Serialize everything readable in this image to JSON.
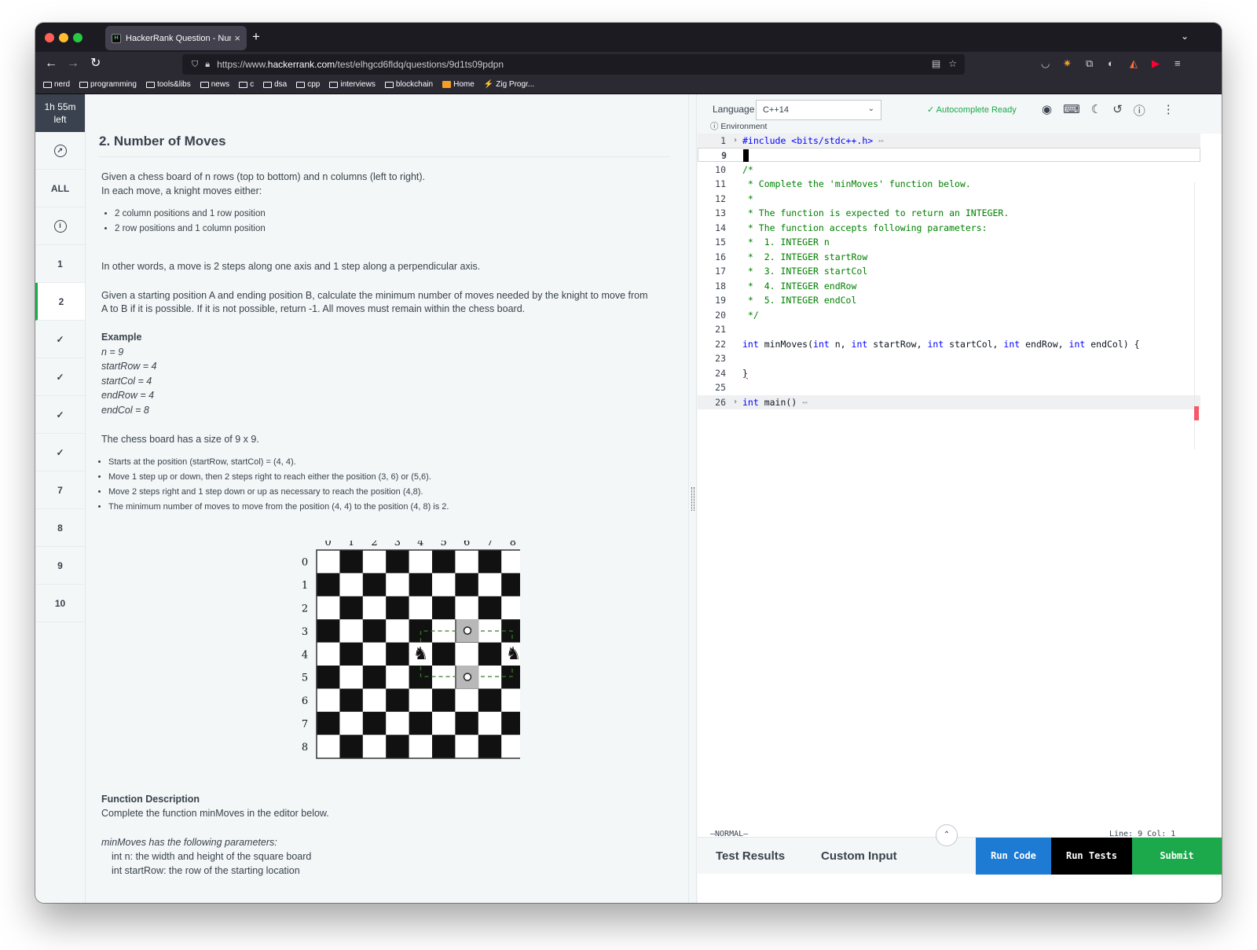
{
  "browser": {
    "tab_title": "HackerRank Question - Number",
    "url_prefix": "https://www.",
    "url_domain": "hackerrank.com",
    "url_path": "/test/elhgcd6fldq/questions/9d1ts09pdpn",
    "bookmarks": [
      "nerd",
      "programming",
      "tools&libs",
      "news",
      "c",
      "dsa",
      "cpp",
      "interviews",
      "blockchain",
      "Home",
      "Zig Progr..."
    ]
  },
  "sidebar": {
    "timer_line1": "1h 55m",
    "timer_line2": "left",
    "items": [
      {
        "label": "",
        "icon": "compass-icon"
      },
      {
        "label": "ALL"
      },
      {
        "label": "",
        "icon": "info-icon"
      },
      {
        "label": "1"
      },
      {
        "label": "2"
      },
      {
        "label": "✓"
      },
      {
        "label": "✓"
      },
      {
        "label": "✓"
      },
      {
        "label": "✓"
      },
      {
        "label": "7"
      },
      {
        "label": "8"
      },
      {
        "label": "9"
      },
      {
        "label": "10"
      }
    ]
  },
  "problem": {
    "title": "2. Number of Moves",
    "intro1": "Given a chess board of n rows (top to bottom) and n columns (left to right).",
    "intro2": "In each move, a knight moves either:",
    "bullets1": [
      "2 column positions and 1 row position",
      "2 row positions and 1 column position"
    ],
    "other_words": "In other words, a move is 2 steps along one axis and 1 step along a perpendicular axis.",
    "given1": "Given a starting position A and ending position B, calculate the minimum number of moves needed by the knight to move from",
    "given2": "A to B if it is possible. If it is not possible, return -1. All moves must remain within the chess board.",
    "example_label": "Example",
    "example_lines": [
      "n = 9",
      "startRow = 4",
      "startCol = 4",
      "endRow = 4",
      "endCol = 8"
    ],
    "board_size_text": "The chess board has a size of  9 x 9.",
    "bullets2": [
      "Starts at the position (startRow, startCol) = (4, 4).",
      "Move 1 step up or down, then 2 steps right to reach either the position (3, 6) or (5,6).",
      "Move 2 steps right and 1 step down or up as necessary to reach the position (4,8).",
      "The minimum number of moves to move from the position (4, 4) to the position (4, 8) is 2."
    ],
    "board_labels": [
      "0",
      "1",
      "2",
      "3",
      "4",
      "5",
      "6",
      "7",
      "8"
    ],
    "func_desc_label": "Function Description",
    "func_desc": "Complete the function minMoves in the editor below.",
    "params_label": "minMoves has  the following parameters:",
    "param1": "int n: the width and height of the square board",
    "param2": "int startRow: the row of the starting location"
  },
  "editor": {
    "language_label": "Language",
    "language_value": "C++14",
    "autocomplete": "Autocomplete Ready",
    "environment": "Environment",
    "mode": "—NORMAL—",
    "cursor_pos": "Line: 9 Col: 1",
    "code_lines": [
      {
        "n": "1",
        "t": "#include <bits/stdc++.h>"
      },
      {
        "n": "9",
        "t": ""
      },
      {
        "n": "10",
        "t": "/*"
      },
      {
        "n": "11",
        "t": " * Complete the 'minMoves' function below."
      },
      {
        "n": "12",
        "t": " *"
      },
      {
        "n": "13",
        "t": " * The function is expected to return an INTEGER."
      },
      {
        "n": "14",
        "t": " * The function accepts following parameters:"
      },
      {
        "n": "15",
        "t": " *  1. INTEGER n"
      },
      {
        "n": "16",
        "t": " *  2. INTEGER startRow"
      },
      {
        "n": "17",
        "t": " *  3. INTEGER startCol"
      },
      {
        "n": "18",
        "t": " *  4. INTEGER endRow"
      },
      {
        "n": "19",
        "t": " *  5. INTEGER endCol"
      },
      {
        "n": "20",
        "t": " */"
      },
      {
        "n": "21",
        "t": ""
      },
      {
        "n": "22",
        "t": "int minMoves(int n, int startRow, int startCol, int endRow, int endCol) {"
      },
      {
        "n": "23",
        "t": ""
      },
      {
        "n": "24",
        "t": "}"
      },
      {
        "n": "25",
        "t": ""
      },
      {
        "n": "26",
        "t": "int main()"
      }
    ],
    "tab_test_results": "Test Results",
    "tab_custom_input": "Custom Input",
    "run_code": "Run Code",
    "run_tests": "Run Tests",
    "submit": "Submit",
    "colors": {
      "run_code": "#1d7bd4",
      "run_tests": "#000000",
      "submit": "#1ba94c"
    }
  }
}
